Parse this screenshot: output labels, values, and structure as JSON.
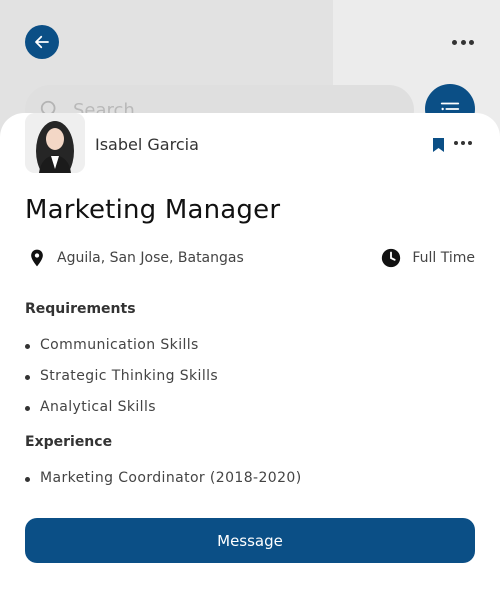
{
  "background": {
    "search": {
      "placeholder": "Search"
    }
  },
  "job": {
    "author": "Isabel Garcia",
    "title": "Marketing Manager",
    "location": "Aguila, San Jose, Batangas",
    "type": "Full Time",
    "requirements_title": "Requirements",
    "requirements": [
      "Communication Skills",
      "Strategic Thinking Skills",
      "Analytical Skills"
    ],
    "experience_title": "Experience",
    "experience": [
      "Marketing Coordinator (2018-2020)"
    ]
  },
  "actions": {
    "message_label": "Message"
  },
  "colors": {
    "primary": "#0b4f86",
    "text": "#333333"
  },
  "icons": {
    "back": "arrow-left-icon",
    "more": "more-horizontal-icon",
    "search": "search-icon",
    "filter": "filter-list-icon",
    "bookmark": "bookmark-icon",
    "location": "location-pin-icon",
    "clock": "clock-icon"
  }
}
